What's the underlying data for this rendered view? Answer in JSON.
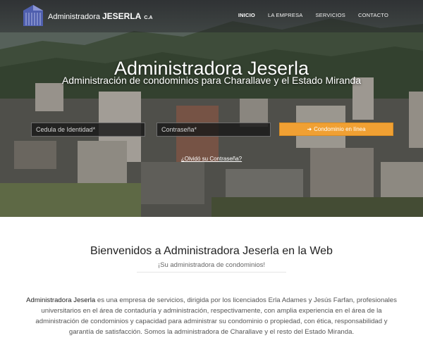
{
  "nav": {
    "brand_name": "Administradora",
    "brand_strong": "JESERLA",
    "brand_suffix": "C.A",
    "items": [
      {
        "label": "INICIO",
        "active": true
      },
      {
        "label": "LA EMPRESA",
        "active": false
      },
      {
        "label": "SERVICIOS",
        "active": false
      },
      {
        "label": "CONTACTO",
        "active": false
      }
    ]
  },
  "hero": {
    "title": "Administradora Jeserla",
    "subtitle": "Administración de condominios para Charallave y el Estado Miranda"
  },
  "login": {
    "cedula_placeholder": "Cedula de Identidad*",
    "password_placeholder": "Contraseña*",
    "button_label": "Condominio en línea",
    "button_icon": "sign-in-icon",
    "forgot_link": "¿Olvidó su Contraseña?"
  },
  "content": {
    "welcome_title": "Bienvenidos a Administradora Jeserla en la Web",
    "tagline": "¡Su administradora de condominios!",
    "paragraph_lead": "Administradora Jeserla",
    "paragraph_body": " es una empresa de servicios, dirigida por los licenciados Erla Adames y Jesús Farfan, profesionales universitarios en el área de contaduría y administración, respectivamente, con amplia experiencia en el área de la administración de condominios y capacidad para administrar su condominio o propiedad, con ética, responsabilidad y garantía de satisfacción. Somos la administradora de Charallave y el resto del Estado Miranda."
  },
  "colors": {
    "accent": "#f0a033",
    "nav_bg": "#2a2a30",
    "logo": "#5a6ab8"
  }
}
